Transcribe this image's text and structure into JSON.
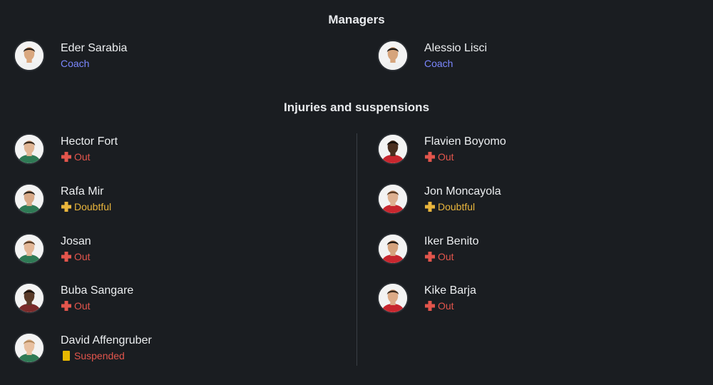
{
  "managers": {
    "title": "Managers",
    "left": {
      "name": "Eder Sarabia",
      "role": "Coach",
      "kit": "#f0f0f0",
      "skin": "#d9a77f",
      "hair": "#2b2119"
    },
    "right": {
      "name": "Alessio Lisci",
      "role": "Coach",
      "kit": "#f0f0f0",
      "skin": "#d6a47c",
      "hair": "#1f1a15"
    }
  },
  "injuries": {
    "title": "Injuries and suspensions",
    "left": [
      {
        "name": "Hector Fort",
        "status": "Out",
        "type": "out",
        "kit": "#2f7a55",
        "skin": "#e0b594",
        "hair": "#3a2a1c"
      },
      {
        "name": "Rafa Mir",
        "status": "Doubtful",
        "type": "doubtful",
        "kit": "#2f7a55",
        "skin": "#d8a987",
        "hair": "#2e241b"
      },
      {
        "name": "Josan",
        "status": "Out",
        "type": "out",
        "kit": "#2f7a55",
        "skin": "#e3b797",
        "hair": "#5a3d26"
      },
      {
        "name": "Buba Sangare",
        "status": "Out",
        "type": "out",
        "kit": "#7a2a2a",
        "skin": "#5a3a28",
        "hair": "#1a120c"
      },
      {
        "name": "David Affengruber",
        "status": "Suspended",
        "type": "suspended",
        "kit": "#2f7a55",
        "skin": "#e8c0a0",
        "hair": "#b58b5e"
      }
    ],
    "right": [
      {
        "name": "Flavien Boyomo",
        "status": "Out",
        "type": "out",
        "kit": "#c8262e",
        "skin": "#4a2e1f",
        "hair": "#140d08"
      },
      {
        "name": "Jon Moncayola",
        "status": "Doubtful",
        "type": "doubtful",
        "kit": "#c8262e",
        "skin": "#deb090",
        "hair": "#5a3a22"
      },
      {
        "name": "Iker Benito",
        "status": "Out",
        "type": "out",
        "kit": "#c8262e",
        "skin": "#d5a27c",
        "hair": "#1e1610"
      },
      {
        "name": "Kike Barja",
        "status": "Out",
        "type": "out",
        "kit": "#c8262e",
        "skin": "#dcaa86",
        "hair": "#3a2a1d"
      }
    ]
  },
  "colors": {
    "background": "#1a1d21",
    "coach_role": "#7b87ff",
    "out": "#e2554c",
    "doubtful": "#e9b53c",
    "suspended_card": "#e8b800"
  }
}
